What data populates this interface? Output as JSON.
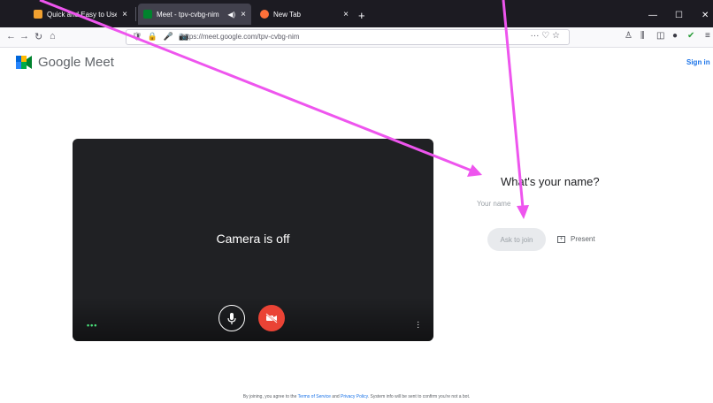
{
  "browser": {
    "tabs": [
      {
        "title": "Quick and Easy to Use Video",
        "favicon_color": "#f0a030"
      },
      {
        "title": "Meet - tpv-cvbg-nim",
        "favicon_color": "#00832d"
      },
      {
        "title": "New Tab",
        "favicon_color": "#ff7139"
      }
    ],
    "url": "https://meet.google.com/tpv-cvbg-nim"
  },
  "header": {
    "brand": "Google Meet",
    "sign_in": "Sign in"
  },
  "preview": {
    "camera_status": "Camera is off"
  },
  "join": {
    "prompt": "What's your name?",
    "name_placeholder": "Your name",
    "ask_to_join": "Ask to join",
    "present": "Present"
  },
  "footer": {
    "before": "By joining, you agree to the ",
    "terms": "Terms of Service",
    "and": " and ",
    "privacy": "Privacy Policy",
    "after": ". System info will be sent to confirm you're not a bot."
  },
  "colors": {
    "accent": "#1a73e8",
    "cam_off_red": "#ea4335",
    "annotation": "#ee55ee"
  }
}
